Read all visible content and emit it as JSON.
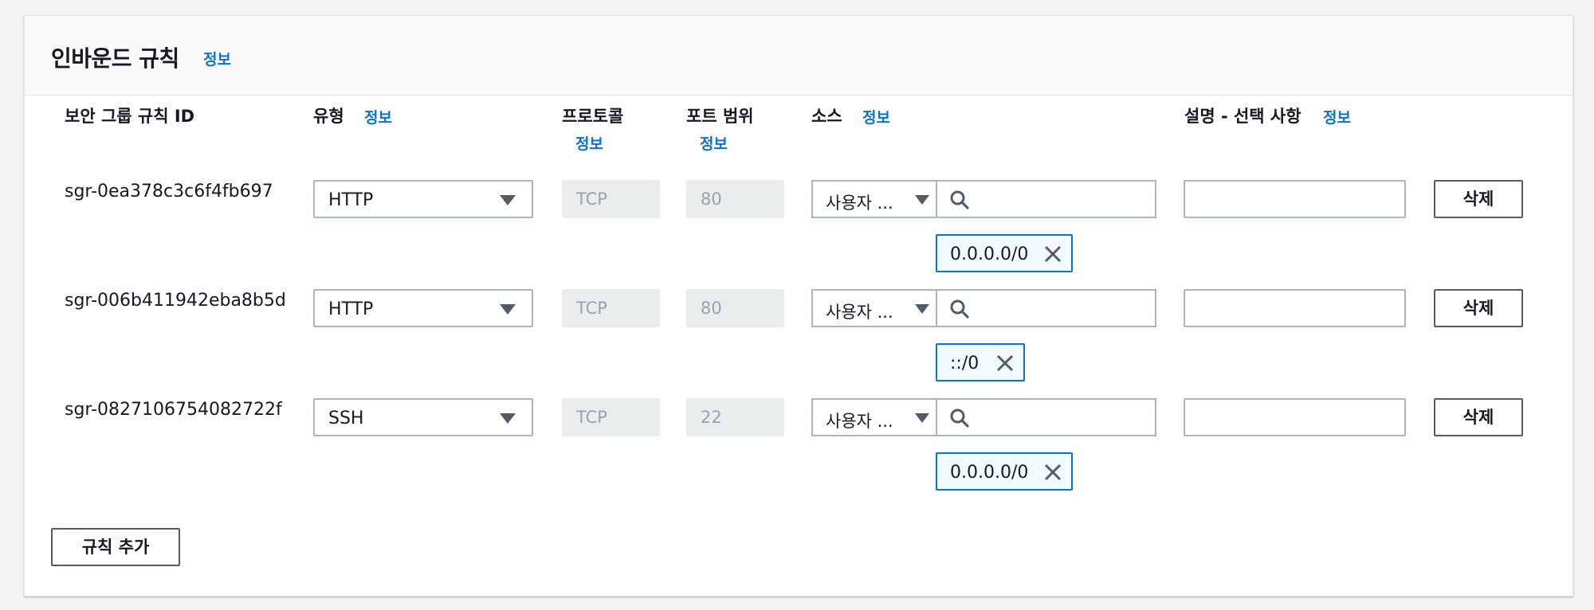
{
  "panel": {
    "title": "인바운드 규칙",
    "info_label": "정보"
  },
  "columns": {
    "rule_id": "보안 그룹 규칙 ID",
    "type": "유형",
    "type_info": "정보",
    "protocol": "프로토콜",
    "protocol_info": "정보",
    "port_range": "포트 범위",
    "port_range_info": "정보",
    "source": "소스",
    "source_info": "정보",
    "description": "설명 - 선택 사항",
    "description_info": "정보"
  },
  "rules": [
    {
      "id": "sgr-0ea378c3c6f4fb697",
      "type": "HTTP",
      "protocol": "TCP",
      "port": "80",
      "source_type": "사용자 ...",
      "source_search": "",
      "source_token": "0.0.0.0/0",
      "description": "",
      "delete_label": "삭제"
    },
    {
      "id": "sgr-006b411942eba8b5d",
      "type": "HTTP",
      "protocol": "TCP",
      "port": "80",
      "source_type": "사용자 ...",
      "source_search": "",
      "source_token": "::/0",
      "description": "",
      "delete_label": "삭제"
    },
    {
      "id": "sgr-0827106754082722f",
      "type": "SSH",
      "protocol": "TCP",
      "port": "22",
      "source_type": "사용자 ...",
      "source_search": "",
      "source_token": "0.0.0.0/0",
      "description": "",
      "delete_label": "삭제"
    }
  ],
  "add_rule_label": "규칙 추가",
  "icons": {
    "caret": "caret-down-icon",
    "search": "search-icon",
    "remove": "close-icon"
  },
  "colors": {
    "link": "#0972d3",
    "token_border": "#0972d3",
    "token_bg": "#f1faff",
    "readonly_bg": "#eaeded"
  }
}
